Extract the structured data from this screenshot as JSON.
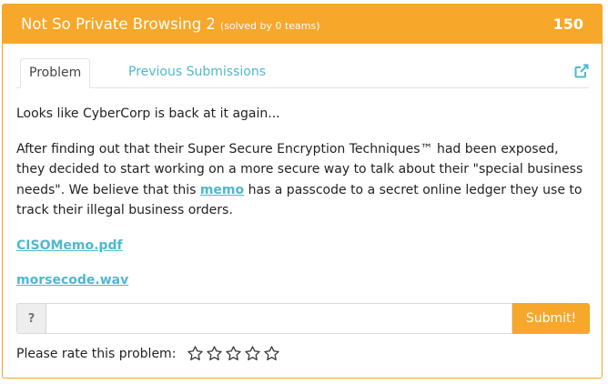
{
  "header": {
    "title": "Not So Private Browsing 2",
    "solved": "(solved by 0 teams)",
    "points": "150",
    "bg_color": "#f7a72a"
  },
  "tabs": {
    "problem_label": "Problem",
    "previous_label": "Previous Submissions",
    "external_icon": "external-link-icon"
  },
  "content": {
    "intro": "Looks like CyberCorp is back at it again...",
    "para_before_link": "After finding out that their Super Secure Encryption Techniques™ had been exposed, they decided to start working on a more secure way to talk about their \"special business needs\". We believe that this ",
    "memo_link": "memo",
    "para_after_link": " has a passcode to a secret online ledger they use to track their illegal business orders.",
    "files": [
      "CISOMemo.pdf",
      "morsecode.wav"
    ],
    "link_color": "#4fb8cc"
  },
  "answer": {
    "addon": "?",
    "value": "",
    "placeholder": "",
    "submit_label": "Submit!"
  },
  "rating": {
    "label": "Please rate this problem:",
    "max_stars": 5,
    "selected": 0,
    "star_icon": "star-outline-icon"
  }
}
